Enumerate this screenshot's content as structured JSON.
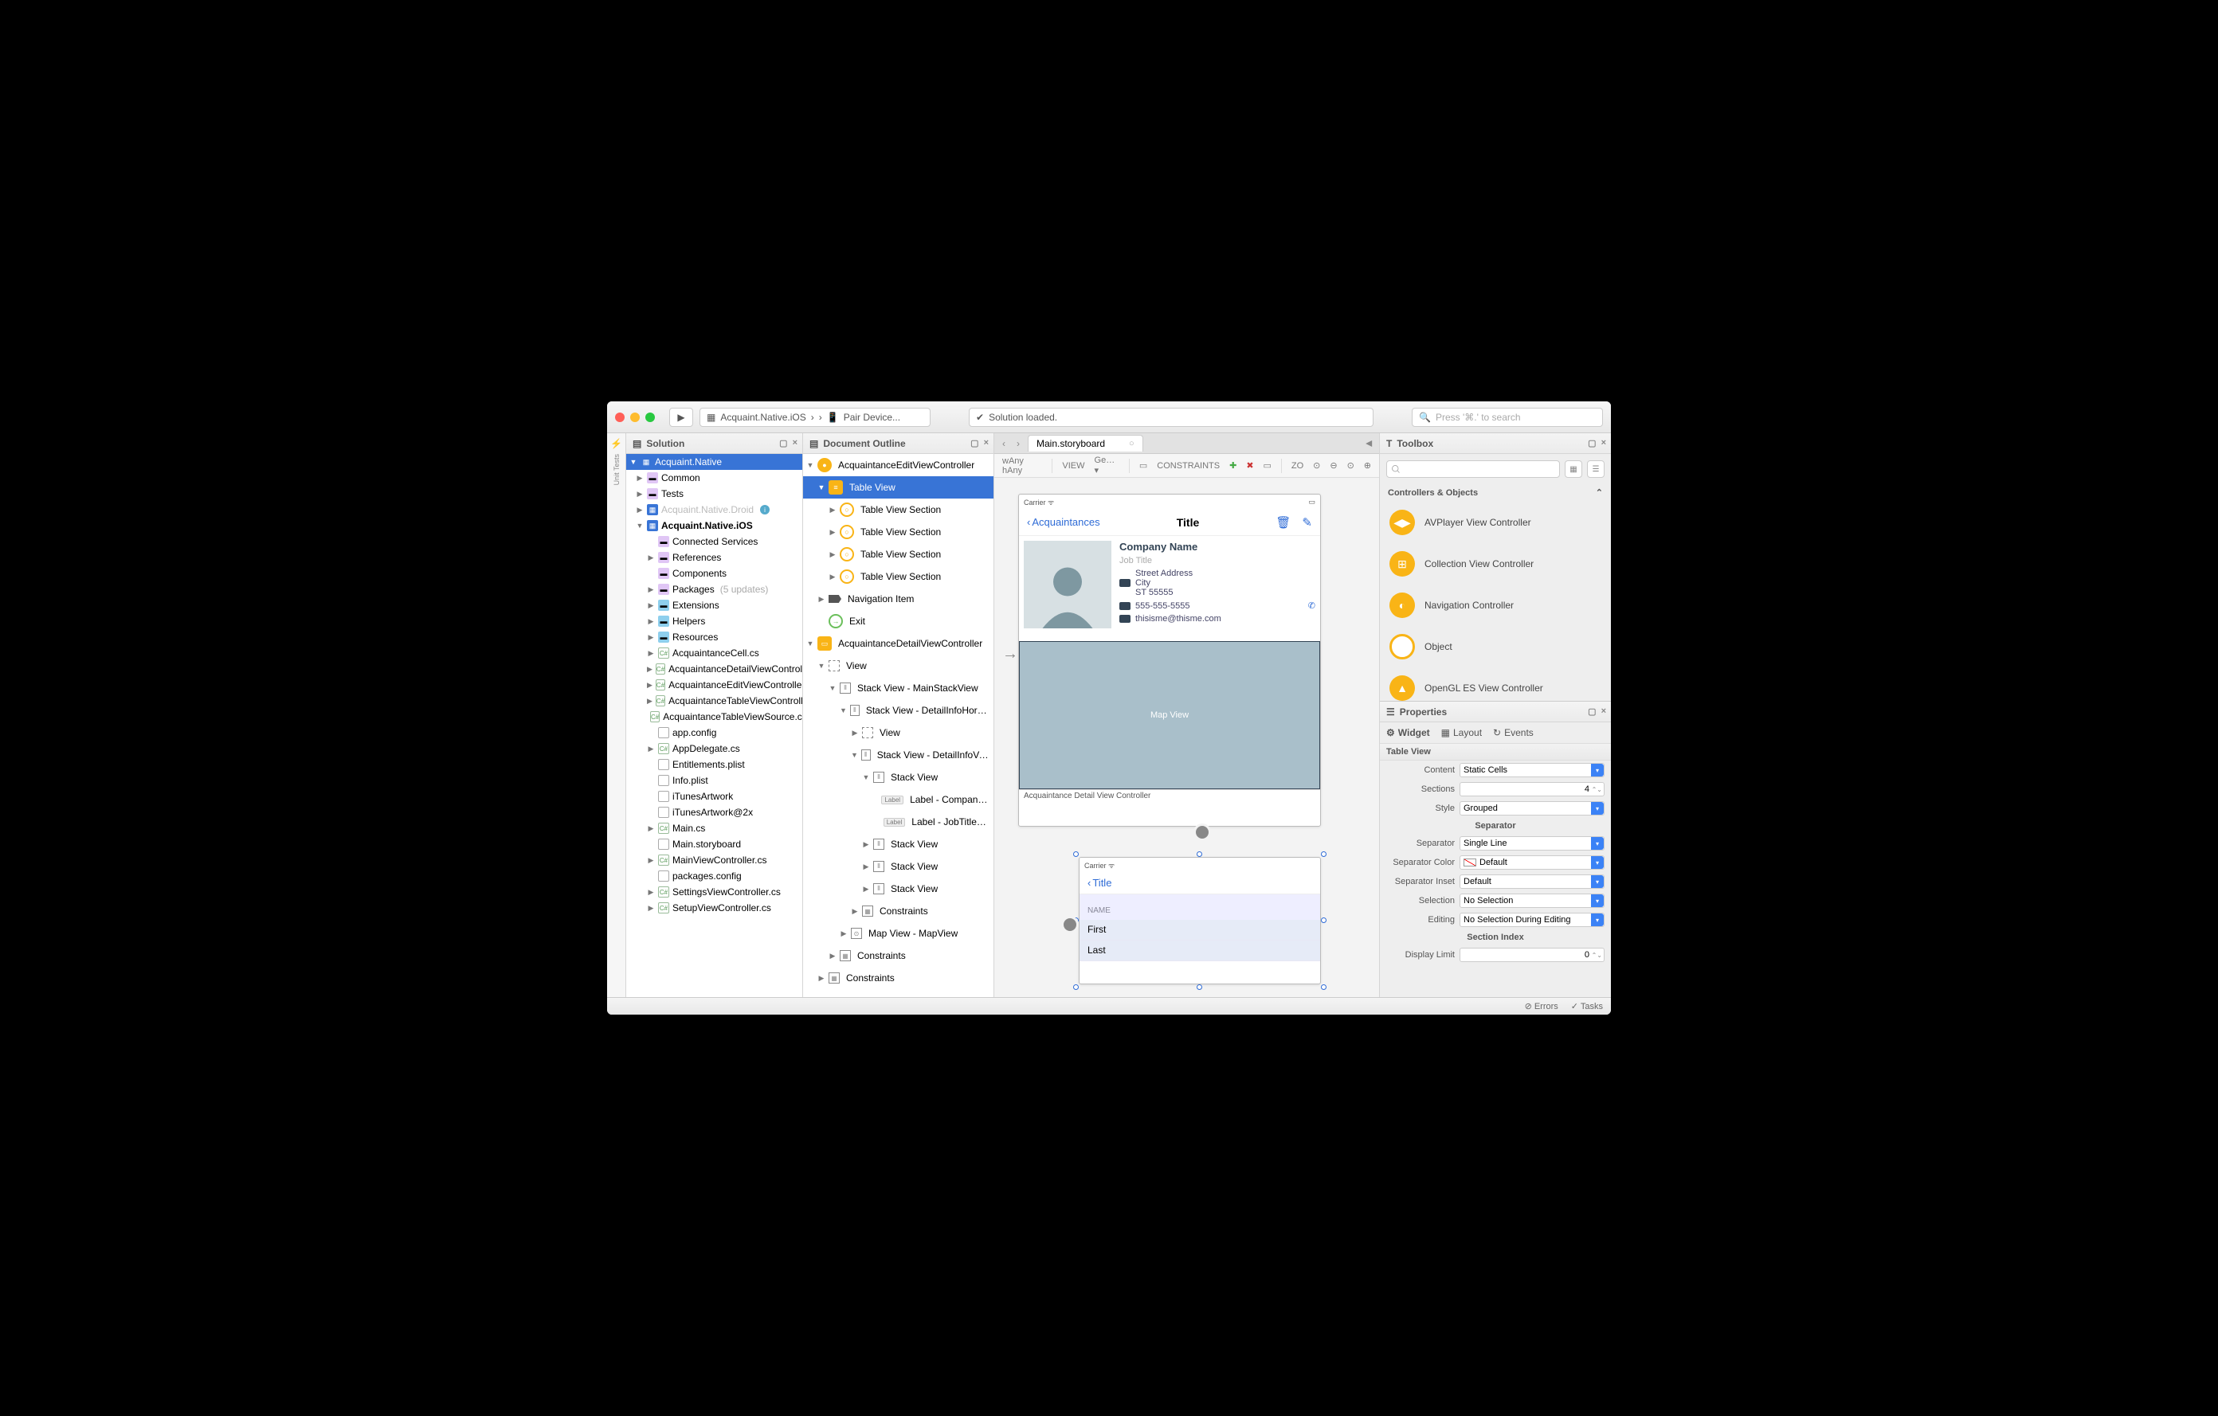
{
  "titlebar": {
    "breadcrumb_project": "Acquaint.Native.iOS",
    "breadcrumb_target": "Pair Device...",
    "status": "Solution loaded.",
    "search_placeholder": "Press '⌘.' to search"
  },
  "rail": {
    "unit_tests": "Unit Tests"
  },
  "solution": {
    "title": "Solution",
    "root": "Acquaint.Native",
    "items": [
      {
        "label": "Common",
        "caret": "▶",
        "icon": "folder"
      },
      {
        "label": "Tests",
        "caret": "▶",
        "icon": "folder"
      },
      {
        "label": "Acquaint.Native.Droid",
        "caret": "▶",
        "icon": "proj",
        "disabled": true,
        "info": true
      },
      {
        "label": "Acquaint.Native.iOS",
        "caret": "▼",
        "icon": "proj",
        "bold": true
      },
      {
        "label": "Connected Services",
        "indent": 1,
        "icon": "folder"
      },
      {
        "label": "References",
        "caret": "▶",
        "indent": 1,
        "icon": "folder"
      },
      {
        "label": "Components",
        "indent": 1,
        "icon": "folder"
      },
      {
        "label": "Packages",
        "caret": "▶",
        "indent": 1,
        "icon": "folder",
        "suffix": "(5 updates)"
      },
      {
        "label": "Extensions",
        "caret": "▶",
        "indent": 1,
        "icon": "folder-b"
      },
      {
        "label": "Helpers",
        "caret": "▶",
        "indent": 1,
        "icon": "folder-b"
      },
      {
        "label": "Resources",
        "caret": "▶",
        "indent": 1,
        "icon": "folder-b"
      },
      {
        "label": "AcquaintanceCell.cs",
        "caret": "▶",
        "indent": 1,
        "icon": "cs"
      },
      {
        "label": "AcquaintanceDetailViewController.cs",
        "caret": "▶",
        "indent": 1,
        "icon": "cs",
        "clip": true
      },
      {
        "label": "AcquaintanceEditViewController.cs",
        "caret": "▶",
        "indent": 1,
        "icon": "cs",
        "clip": true
      },
      {
        "label": "AcquaintanceTableViewController.cs",
        "caret": "▶",
        "indent": 1,
        "icon": "cs",
        "clip": true
      },
      {
        "label": "AcquaintanceTableViewSource.cs",
        "indent": 1,
        "icon": "cs",
        "clip": true
      },
      {
        "label": "app.config",
        "indent": 1,
        "icon": "plist"
      },
      {
        "label": "AppDelegate.cs",
        "caret": "▶",
        "indent": 1,
        "icon": "cs"
      },
      {
        "label": "Entitlements.plist",
        "indent": 1,
        "icon": "plist"
      },
      {
        "label": "Info.plist",
        "indent": 1,
        "icon": "plist"
      },
      {
        "label": "iTunesArtwork",
        "indent": 1,
        "icon": "plist"
      },
      {
        "label": "iTunesArtwork@2x",
        "indent": 1,
        "icon": "plist"
      },
      {
        "label": "Main.cs",
        "caret": "▶",
        "indent": 1,
        "icon": "cs"
      },
      {
        "label": "Main.storyboard",
        "indent": 1,
        "icon": "plist"
      },
      {
        "label": "MainViewController.cs",
        "caret": "▶",
        "indent": 1,
        "icon": "cs"
      },
      {
        "label": "packages.config",
        "indent": 1,
        "icon": "plist"
      },
      {
        "label": "SettingsViewController.cs",
        "caret": "▶",
        "indent": 1,
        "icon": "cs"
      },
      {
        "label": "SetupViewController.cs",
        "caret": "▶",
        "indent": 1,
        "icon": "cs"
      }
    ]
  },
  "outline": {
    "title": "Document Outline",
    "items": [
      {
        "label": "AcquaintanceEditViewController",
        "caret": "▼",
        "icon": "oi-filled",
        "indent": 0
      },
      {
        "label": "Table View",
        "caret": "▼",
        "icon": "oi-sq",
        "indent": 1,
        "selected": true
      },
      {
        "label": "Table View Section",
        "caret": "▶",
        "icon": "oi",
        "indent": 2
      },
      {
        "label": "Table View Section",
        "caret": "▶",
        "icon": "oi",
        "indent": 2
      },
      {
        "label": "Table View Section",
        "caret": "▶",
        "icon": "oi",
        "indent": 2
      },
      {
        "label": "Table View Section",
        "caret": "▶",
        "icon": "oi",
        "indent": 2
      },
      {
        "label": "Navigation Item",
        "caret": "▶",
        "icon": "tag",
        "indent": 1
      },
      {
        "label": "Exit",
        "icon": "exit",
        "indent": 1
      },
      {
        "label": "AcquaintanceDetailViewController",
        "caret": "▼",
        "icon": "oi-sq-filled",
        "indent": 0
      },
      {
        "label": "View",
        "caret": "▼",
        "icon": "gray",
        "indent": 1
      },
      {
        "label": "Stack View - MainStackView",
        "caret": "▼",
        "icon": "sv",
        "indent": 2
      },
      {
        "label": "Stack View - DetailInfoHorizontal…",
        "caret": "▼",
        "icon": "sv",
        "indent": 3,
        "clip": true
      },
      {
        "label": "View",
        "caret": "▶",
        "icon": "gray",
        "indent": 4
      },
      {
        "label": "Stack View - DetailInfoVertical…",
        "caret": "▼",
        "icon": "sv",
        "indent": 4,
        "clip": true
      },
      {
        "label": "Stack View",
        "caret": "▼",
        "icon": "sv",
        "indent": 5
      },
      {
        "label": "Label - CompanyNameLabel",
        "icon": "lab",
        "indent": 6,
        "clip": true
      },
      {
        "label": "Label - JobTitleLabel",
        "icon": "lab",
        "indent": 6
      },
      {
        "label": "Stack View",
        "caret": "▶",
        "icon": "sv",
        "indent": 5
      },
      {
        "label": "Stack View",
        "caret": "▶",
        "icon": "sv",
        "indent": 5
      },
      {
        "label": "Stack View",
        "caret": "▶",
        "icon": "sv",
        "indent": 5
      },
      {
        "label": "Constraints",
        "caret": "▶",
        "icon": "con",
        "indent": 4
      },
      {
        "label": "Map View - MapView",
        "caret": "▶",
        "icon": "map",
        "indent": 3
      },
      {
        "label": "Constraints",
        "caret": "▶",
        "icon": "con",
        "indent": 2
      },
      {
        "label": "Constraints",
        "caret": "▶",
        "icon": "con",
        "indent": 1
      }
    ]
  },
  "tabs": {
    "active": "Main.storyboard"
  },
  "designbar": {
    "wany": "wAny",
    "hany": "hAny",
    "view": "VIEW",
    "viewval": "Genesi",
    "constraints": "CONSTRAINTS",
    "zoom": "ZOOM"
  },
  "detail_vc": {
    "carrier": "Carrier",
    "back": "Acquaintances",
    "title": "Title",
    "company": "Company Name",
    "job": "Job Title",
    "street": "Street Address",
    "city": "City",
    "zip": "ST 55555",
    "phone": "555-555-5555",
    "email": "thisisme@thisme.com",
    "map": "Map View",
    "footer": "Acquaintance Detail View Controller"
  },
  "edit_vc": {
    "carrier": "Carrier",
    "title": "Title",
    "section": "NAME",
    "first": "First",
    "last": "Last"
  },
  "toolbox": {
    "title": "Toolbox",
    "section": "Controllers & Objects",
    "items": [
      "AVPlayer View Controller",
      "Collection View Controller",
      "Navigation Controller",
      "Object",
      "OpenGL ES View Controller"
    ]
  },
  "properties": {
    "title": "Properties",
    "tabs": {
      "widget": "Widget",
      "layout": "Layout",
      "events": "Events"
    },
    "header": "Table View",
    "content": "Static Cells",
    "sections": "4",
    "style": "Grouped",
    "sep_h": "Separator",
    "separator": "Single Line",
    "sep_color": "Default",
    "sep_inset": "Default",
    "selection": "No Selection",
    "editing": "No Selection During Editing",
    "idx_h": "Section Index",
    "display_limit": "0",
    "labels": {
      "content": "Content",
      "sections": "Sections",
      "style": "Style",
      "separator": "Separator",
      "sep_color": "Separator Color",
      "sep_inset": "Separator Inset",
      "selection": "Selection",
      "editing": "Editing",
      "display_limit": "Display Limit"
    }
  },
  "statusbar": {
    "errors": "Errors",
    "tasks": "Tasks"
  }
}
